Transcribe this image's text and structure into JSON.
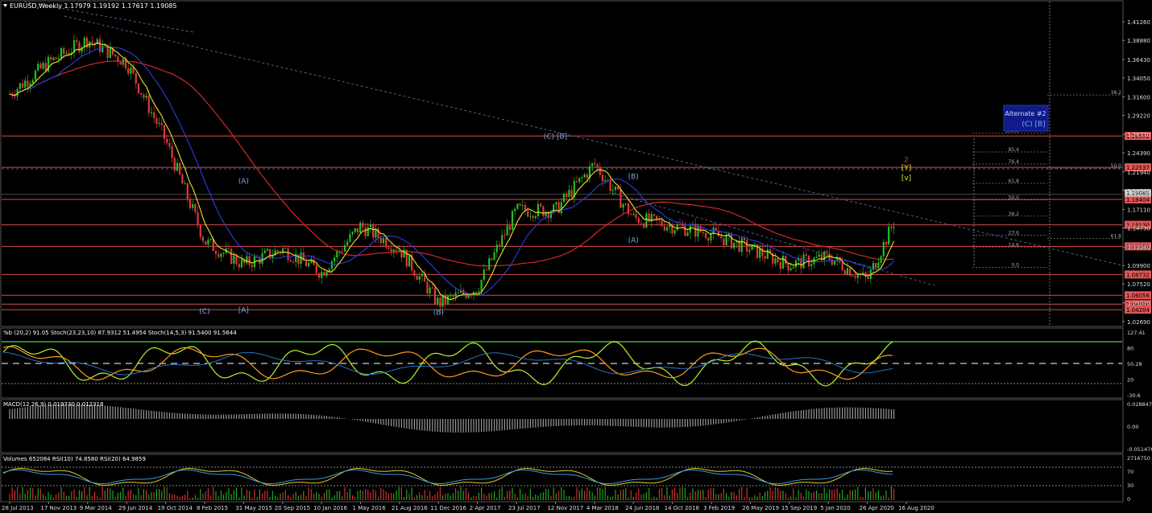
{
  "window": {
    "symbol_line": "EURUSD,Weekly  1.17979 1.19192 1.17617 1.19085"
  },
  "colors": {
    "background": "#000000",
    "bull_candle": "#22c022",
    "bear_candle": "#e03a3a",
    "ma_red": "#e52b2b",
    "ma_blue": "#2a3fe0",
    "ma_yellow": "#e6e62a",
    "level_line": "#d84a4a",
    "level_box": "#e05555",
    "wave_label": "#7aa8e0",
    "fib_text": "#aaaaaa",
    "stoch_green": "#b7f22a",
    "stoch_orange": "#ff9a1a",
    "stoch_blue": "#2a7fd8",
    "macd_hist": "#9a9a9a",
    "rsi_yellow": "#e6c82a",
    "rsi_blue": "#3a9ae0",
    "vol_green": "#1fa81f",
    "vol_red": "#d03030"
  },
  "chart_data": {
    "type": "candlestick",
    "symbol": "EURUSD",
    "timeframe": "Weekly",
    "ohlc_last": {
      "open": 1.17979,
      "high": 1.19192,
      "low": 1.17617,
      "close": 1.19085
    },
    "price_axis": {
      "ylim": [
        1.0225,
        1.4346
      ],
      "ticks": [
        "1.41260",
        "1.38880",
        "1.36430",
        "1.34050",
        "1.31600",
        "1.29220",
        "1.26770",
        "1.24390",
        "1.21940",
        "1.19560",
        "1.17110",
        "1.14730",
        "1.12280",
        "1.09900",
        "1.07520",
        "1.05070",
        "1.02690"
      ]
    },
    "levels": [
      {
        "price": 1.26572,
        "label": "1.26572"
      },
      {
        "price": 1.22537,
        "label": "1.22537"
      },
      {
        "price": 1.18404,
        "label": "1.18404"
      },
      {
        "price": 1.1513,
        "label": "1.15130"
      },
      {
        "price": 1.12358,
        "label": "1.12358"
      },
      {
        "price": 1.08732,
        "label": "1.08732"
      },
      {
        "price": 1.06056,
        "label": "1.06056"
      },
      {
        "price": 1.0492,
        "label": "1.04920"
      },
      {
        "price": 1.04204,
        "label": "1.04204"
      }
    ],
    "current_price_label": "1.19085",
    "x_axis": {
      "dates": [
        "28 Jul 2013",
        "17 Nov 2013",
        "9 Mar 2014",
        "29 Jun 2014",
        "19 Oct 2014",
        "8 Feb 2015",
        "31 May 2015",
        "20 Sep 2015",
        "10 Jan 2016",
        "1 May 2016",
        "21 Aug 2016",
        "11 Dec 2016",
        "2 Apr 2017",
        "23 Jul 2017",
        "12 Nov 2017",
        "4 Mar 2018",
        "24 Jun 2018",
        "14 Oct 2018",
        "3 Feb 2019",
        "26 May 2019",
        "15 Sep 2019",
        "5 Jan 2020",
        "26 Apr 2020",
        "16 Aug 2020"
      ]
    },
    "price_path": [
      [
        "28 Jul 2013",
        1.32
      ],
      [
        "17 Nov 2013",
        1.36
      ],
      [
        "9 Mar 2014",
        1.39
      ],
      [
        "29 Jun 2014",
        1.36
      ],
      [
        "19 Oct 2014",
        1.26
      ],
      [
        "8 Feb 2015",
        1.13
      ],
      [
        "31 May 2015",
        1.1
      ],
      [
        "20 Sep 2015",
        1.12
      ],
      [
        "10 Jan 2016",
        1.09
      ],
      [
        "1 May 2016",
        1.15
      ],
      [
        "21 Aug 2016",
        1.12
      ],
      [
        "11 Dec 2016",
        1.05
      ],
      [
        "2 Apr 2017",
        1.07
      ],
      [
        "23 Jul 2017",
        1.17
      ],
      [
        "12 Nov 2017",
        1.17
      ],
      [
        "4 Mar 2018",
        1.23
      ],
      [
        "24 Jun 2018",
        1.16
      ],
      [
        "14 Oct 2018",
        1.15
      ],
      [
        "3 Feb 2019",
        1.14
      ],
      [
        "26 May 2019",
        1.12
      ],
      [
        "15 Sep 2019",
        1.1
      ],
      [
        "5 Jan 2020",
        1.11
      ],
      [
        "26 Apr 2020",
        1.08
      ],
      [
        "16 Aug 2020",
        1.19
      ]
    ],
    "fib_levels": [
      {
        "label": "100.0",
        "price": 1.2692
      },
      {
        "label": "85.4",
        "price": 1.2451
      },
      {
        "label": "76.4",
        "price": 1.2296
      },
      {
        "label": "61.8",
        "price": 1.2047
      },
      {
        "label": "50.0",
        "price": 1.1833
      },
      {
        "label": "38.2",
        "price": 1.1625
      },
      {
        "label": "23.6",
        "price": 1.1378
      },
      {
        "label": "14.6",
        "price": 1.1222
      },
      {
        "label": "0.0",
        "price": 1.0965
      }
    ],
    "fib_right": [
      {
        "label": "38.2",
        "price": 1.3185
      },
      {
        "label": "50.0",
        "price": 1.2243
      },
      {
        "label": "61.8",
        "price": 1.1337
      }
    ],
    "wave_labels": [
      {
        "text": "(C) [B]",
        "date": "12 Nov 2017",
        "price": 1.262
      },
      {
        "text": "(A)",
        "date": "31 May 2015",
        "price": 1.2045
      },
      {
        "text": "(B)",
        "date": "24 Jun 2018",
        "price": 1.2105
      },
      {
        "text": "(A)",
        "date": "24 Jun 2018",
        "price": 1.1285
      },
      {
        "text": "(C)",
        "date": "8 Feb 2015",
        "price": 1.037
      },
      {
        "text": "[A]",
        "date": "31 May 2015",
        "price": 1.0385
      },
      {
        "text": "(B)",
        "date": "11 Dec 2016",
        "price": 1.0355
      },
      {
        "text": "2",
        "date": "16 Aug 2020",
        "price": 1.232
      },
      {
        "text": "[Y]",
        "date": "16 Aug 2020",
        "price": 1.222
      },
      {
        "text": "[v]",
        "date": "16 Aug 2020",
        "price": 1.209
      }
    ],
    "annotation_box": {
      "line1": "Alternate #2",
      "line2": "(C) [B]"
    },
    "indicators": {
      "stoch_panel": {
        "label": "%b (20,2) 91.05  Stoch(23,23,10) 87.9312 51.4954  Stoch(14,5,3) 91.5400 91.5644",
        "ticks": [
          "127.41",
          "80",
          "50.28",
          "20",
          "-30.6"
        ]
      },
      "macd_panel": {
        "label": "MACD(12,26,9) 0.019730 0.012318",
        "ticks": [
          "0.028847",
          "0.00",
          "-0.051476"
        ]
      },
      "rsi_panel": {
        "label": "Volumes 652084  RSI(10) 74.8580  RSI(20) 64.9859",
        "ticks": [
          "2716750",
          "70",
          "30",
          "0"
        ]
      }
    }
  }
}
